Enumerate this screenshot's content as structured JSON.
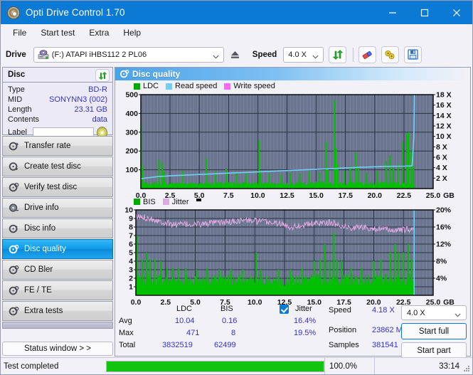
{
  "window": {
    "title": "Opti Drive Control 1.70",
    "icon": "disc-icon",
    "minimize": "–",
    "maximize": "□",
    "close": "✕"
  },
  "menu": {
    "items": [
      "File",
      "Start test",
      "Extra",
      "Help"
    ]
  },
  "toolbar": {
    "drive_label": "Drive",
    "drive_value": "(F:)  ATAPI iHBS112  2 PL06",
    "eject_icon": "eject-icon",
    "speed_label": "Speed",
    "speed_value": "4.0 X",
    "refresh_icon": "refresh-icon",
    "erase_icon": "eraser-icon",
    "tools_icon": "tools-icon",
    "save_icon": "save-icon"
  },
  "disc_panel": {
    "title": "Disc",
    "refresh_icon": "refresh-icon",
    "rows": [
      {
        "key": "Type",
        "value": "BD-R"
      },
      {
        "key": "MID",
        "value": "SONYNN3 (002)"
      },
      {
        "key": "Length",
        "value": "23.31 GB"
      },
      {
        "key": "Contents",
        "value": "data"
      }
    ],
    "label_key": "Label",
    "label_value": "",
    "label_placeholder": "",
    "label_disc_icon": "disc-icon"
  },
  "sidebar": {
    "items": [
      {
        "label": "Transfer rate",
        "icon": "disc-transfer-icon",
        "active": false
      },
      {
        "label": "Create test disc",
        "icon": "disc-create-icon",
        "active": false
      },
      {
        "label": "Verify test disc",
        "icon": "disc-verify-icon",
        "active": false
      },
      {
        "label": "Drive info",
        "icon": "disc-drive-icon",
        "active": false
      },
      {
        "label": "Disc info",
        "icon": "disc-info-icon",
        "active": false
      },
      {
        "label": "Disc quality",
        "icon": "disc-quality-icon",
        "active": true
      },
      {
        "label": "CD Bler",
        "icon": "disc-bler-icon",
        "active": false
      },
      {
        "label": "FE / TE",
        "icon": "disc-fete-icon",
        "active": false
      },
      {
        "label": "Extra tests",
        "icon": "disc-extra-icon",
        "active": false
      }
    ],
    "status_window_label": "Status window > >"
  },
  "main": {
    "header_title": "Disc quality",
    "header_icon": "disc-quality-icon"
  },
  "stats": {
    "col_ldc": "LDC",
    "col_bis": "BIS",
    "jitter_label": "Jitter",
    "jitter_checked": true,
    "row_avg": "Avg",
    "row_max": "Max",
    "row_total": "Total",
    "avg_ldc": "10.04",
    "avg_bis": "0.16",
    "avg_jitter": "16.4%",
    "max_ldc": "471",
    "max_bis": "8",
    "max_jitter": "19.5%",
    "total_ldc": "3832519",
    "total_bis": "62499",
    "speed_label": "Speed",
    "speed_value": "4.18 X",
    "position_label": "Position",
    "position_value": "23862 MB",
    "samples_label": "Samples",
    "samples_value": "381541",
    "speed_select": "4.0 X",
    "start_full": "Start full",
    "start_part": "Start part"
  },
  "statusbar": {
    "text": "Test completed",
    "percent": "100.0%",
    "progress": 100,
    "elapsed": "33:14",
    "progress_color": "#12c40f"
  },
  "colors": {
    "accent": "#0b7ad4",
    "value_text": "#3333cc",
    "ldc_green": "#00c000",
    "bis_green": "#00c000",
    "read_speed": "#6fd0f5",
    "write_speed": "#ff66ff",
    "jitter_pink": "#e8a8e0",
    "plot_bg": "#6b7590"
  },
  "chart_data": [
    {
      "type": "line",
      "id": "disc-quality-ldc-chart",
      "title": "",
      "legend": [
        {
          "label": "LDC",
          "color": "#00a800"
        },
        {
          "label": "Read speed",
          "color": "#6fd0f5"
        },
        {
          "label": "Write speed",
          "color": "#ff66ff"
        }
      ],
      "legend_position": "top-left",
      "xlabel": "GB",
      "x_ticks": [
        "0.0",
        "2.5",
        "5.0",
        "7.5",
        "10.0",
        "12.5",
        "15.0",
        "17.5",
        "20.0",
        "22.5",
        "25.0"
      ],
      "xlim": [
        0,
        25
      ],
      "ylabel_left": "LDC",
      "y_ticks_left": [
        "100",
        "200",
        "300",
        "400",
        "500"
      ],
      "ylim_left": [
        0,
        500
      ],
      "ylabel_right": "Speed",
      "y_ticks_right": [
        "2 X",
        "4 X",
        "6 X",
        "8 X",
        "10 X",
        "12 X",
        "14 X",
        "16 X",
        "18 X"
      ],
      "ylim_right": [
        0,
        18
      ],
      "grid": true,
      "series": [
        {
          "name": "LDC",
          "color": "#00c000",
          "type": "spike-area",
          "baseline": 30,
          "x_end": 23.4,
          "spikes": [
            [
              0.05,
              345
            ],
            [
              0.12,
              120
            ],
            [
              1.55,
              155
            ],
            [
              1.85,
              135
            ],
            [
              2.0,
              90
            ],
            [
              3.6,
              95
            ],
            [
              5.6,
              160
            ],
            [
              5.65,
              95
            ],
            [
              6.4,
              90
            ],
            [
              7.3,
              105
            ],
            [
              8.2,
              85
            ],
            [
              9.0,
              80
            ],
            [
              10.1,
              258
            ],
            [
              10.2,
              90
            ],
            [
              11.0,
              80
            ],
            [
              12.0,
              75
            ],
            [
              12.8,
              85
            ],
            [
              13.6,
              80
            ],
            [
              14.4,
              90
            ],
            [
              15.3,
              85
            ],
            [
              15.85,
              248
            ],
            [
              16.0,
              105
            ],
            [
              16.55,
              470
            ],
            [
              16.7,
              215
            ],
            [
              16.85,
              130
            ],
            [
              17.4,
              95
            ],
            [
              17.9,
              120
            ],
            [
              18.4,
              190
            ],
            [
              18.6,
              110
            ],
            [
              19.3,
              85
            ],
            [
              20.2,
              95
            ],
            [
              21.0,
              145
            ],
            [
              21.3,
              175
            ],
            [
              21.6,
              110
            ],
            [
              22.0,
              130
            ],
            [
              22.4,
              250
            ],
            [
              22.75,
              295
            ],
            [
              22.9,
              300
            ],
            [
              23.1,
              200
            ],
            [
              23.3,
              120
            ]
          ]
        },
        {
          "name": "Read speed",
          "color": "#6fd0f5",
          "type": "line",
          "points": [
            [
              0.0,
              1.9
            ],
            [
              1.5,
              2.3
            ],
            [
              3.0,
              2.5
            ],
            [
              5.0,
              2.7
            ],
            [
              7.0,
              2.9
            ],
            [
              9.0,
              3.1
            ],
            [
              11.0,
              3.3
            ],
            [
              13.0,
              3.5
            ],
            [
              15.0,
              3.7
            ],
            [
              17.0,
              3.9
            ],
            [
              19.0,
              4.1
            ],
            [
              21.0,
              4.25
            ],
            [
              22.6,
              4.3
            ],
            [
              23.2,
              4.35
            ],
            [
              23.35,
              10.0
            ],
            [
              23.4,
              18.0
            ]
          ]
        },
        {
          "name": "Write speed",
          "color": "#ff66ff",
          "type": "line",
          "points": []
        }
      ]
    },
    {
      "type": "line",
      "id": "disc-quality-bis-jitter-chart",
      "title": "",
      "legend": [
        {
          "label": "BIS",
          "color": "#00a800"
        },
        {
          "label": "Jitter",
          "color": "#e0a8e0"
        }
      ],
      "legend_position": "top-left",
      "xlabel": "GB",
      "x_ticks": [
        "0.0",
        "2.5",
        "5.0",
        "7.5",
        "10.0",
        "12.5",
        "15.0",
        "17.5",
        "20.0",
        "22.5",
        "25.0"
      ],
      "xlim": [
        0,
        25
      ],
      "ylabel_left": "BIS",
      "y_ticks_left": [
        "1",
        "2",
        "3",
        "4",
        "5",
        "6",
        "7",
        "8",
        "9",
        "10"
      ],
      "ylim_left": [
        0,
        10
      ],
      "ylabel_right": "Jitter",
      "y_ticks_right": [
        "4%",
        "8%",
        "12%",
        "16%",
        "20%"
      ],
      "ylim_right": [
        0,
        20
      ],
      "grid": true,
      "series": [
        {
          "name": "BIS",
          "color": "#00c000",
          "type": "spike-area",
          "baseline": 2.0,
          "x_end": 23.4,
          "spikes": [
            [
              0.05,
              7.0
            ],
            [
              0.55,
              4.2
            ],
            [
              0.9,
              5.0
            ],
            [
              1.2,
              4.2
            ],
            [
              1.6,
              4.2
            ],
            [
              2.1,
              4.0
            ],
            [
              2.6,
              3.2
            ],
            [
              3.1,
              3.2
            ],
            [
              3.6,
              3.2
            ],
            [
              4.2,
              3.2
            ],
            [
              5.1,
              3.0
            ],
            [
              6.0,
              3.2
            ],
            [
              7.0,
              3.0
            ],
            [
              8.0,
              3.0
            ],
            [
              9.0,
              3.0
            ],
            [
              10.1,
              5.0
            ],
            [
              10.5,
              3.0
            ],
            [
              11.3,
              1.2
            ],
            [
              12.0,
              3.0
            ],
            [
              13.0,
              3.0
            ],
            [
              14.0,
              3.2
            ],
            [
              15.0,
              4.0
            ],
            [
              15.5,
              4.2
            ],
            [
              15.9,
              6.0
            ],
            [
              16.3,
              4.0
            ],
            [
              16.65,
              7.3
            ],
            [
              16.9,
              4.2
            ],
            [
              17.3,
              4.0
            ],
            [
              18.1,
              3.2
            ],
            [
              19.0,
              3.2
            ],
            [
              20.0,
              4.0
            ],
            [
              20.6,
              4.2
            ],
            [
              21.4,
              5.0
            ],
            [
              21.8,
              6.0
            ],
            [
              22.1,
              5.0
            ],
            [
              22.5,
              5.0
            ],
            [
              22.9,
              6.0
            ],
            [
              23.2,
              4.2
            ]
          ]
        },
        {
          "name": "Jitter",
          "color": "#e0a8e0",
          "type": "noisy-line",
          "mean_percent": 16.4,
          "x_end": 23.4,
          "envelope": [
            [
              0.0,
              18.4
            ],
            [
              1.0,
              18.2
            ],
            [
              2.0,
              17.4
            ],
            [
              3.0,
              16.6
            ],
            [
              4.0,
              16.6
            ],
            [
              5.0,
              16.6
            ],
            [
              6.0,
              16.8
            ],
            [
              7.0,
              17.0
            ],
            [
              8.0,
              17.2
            ],
            [
              9.0,
              17.6
            ],
            [
              10.0,
              17.4
            ],
            [
              11.0,
              17.2
            ],
            [
              12.0,
              16.8
            ],
            [
              13.0,
              16.0
            ],
            [
              14.0,
              16.4
            ],
            [
              15.0,
              16.8
            ],
            [
              16.0,
              17.2
            ],
            [
              17.0,
              16.6
            ],
            [
              18.0,
              15.8
            ],
            [
              19.0,
              16.0
            ],
            [
              20.0,
              15.6
            ],
            [
              21.0,
              15.4
            ],
            [
              22.0,
              15.2
            ],
            [
              23.0,
              15.4
            ],
            [
              23.4,
              15.6
            ]
          ]
        }
      ]
    }
  ]
}
